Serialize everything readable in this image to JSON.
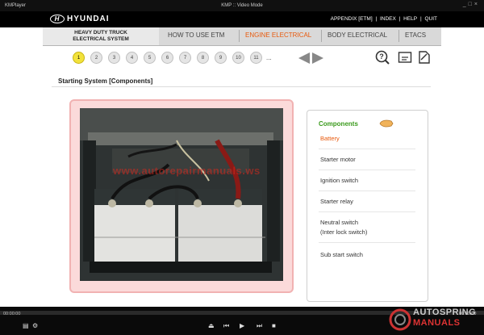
{
  "player": {
    "app_name": "KMPlayer",
    "window_title": "KMP :: Video Mode",
    "time_elapsed": "00:00:00",
    "time_total": "00:00:00",
    "brand_line1": "AUTOSPRING",
    "brand_line2": "MANUALS"
  },
  "header": {
    "logo_text": "HYUNDAI",
    "product_line1": "HEAVY DUTY TRUCK",
    "product_line2": "ELECTRICAL SYSTEM",
    "links": [
      "APPENDIX [ETM]",
      "INDEX",
      "HELP",
      "QUIT"
    ],
    "link_separator": "|"
  },
  "nav": {
    "tabs": [
      {
        "label": "HOW TO USE ETM",
        "active": false
      },
      {
        "label": "ENGINE ELECTRICAL",
        "active": true
      },
      {
        "label": "BODY ELECTRICAL",
        "active": false
      },
      {
        "label": "ETACS",
        "active": false
      }
    ]
  },
  "pager": {
    "pages": [
      "1",
      "2",
      "3",
      "4",
      "5",
      "6",
      "7",
      "8",
      "9",
      "10",
      "11"
    ],
    "current": "1",
    "more": "..."
  },
  "page": {
    "title": "Starting System [Components]",
    "watermark": "www.autorepairmanuals.ws"
  },
  "components": {
    "heading": "Components",
    "items": [
      {
        "label": "Battery",
        "active": true
      },
      {
        "label": "Starter motor",
        "active": false
      },
      {
        "label": "Ignition switch",
        "active": false
      },
      {
        "label": "Starter relay",
        "active": false
      },
      {
        "label": "Neutral switch",
        "label2": "(Inter lock switch)",
        "active": false
      },
      {
        "label": "Sub start switch",
        "active": false
      }
    ]
  },
  "colors": {
    "accent": "#e8590c",
    "heading_green": "#3a9a1c",
    "page_active": "#f2e23b"
  }
}
